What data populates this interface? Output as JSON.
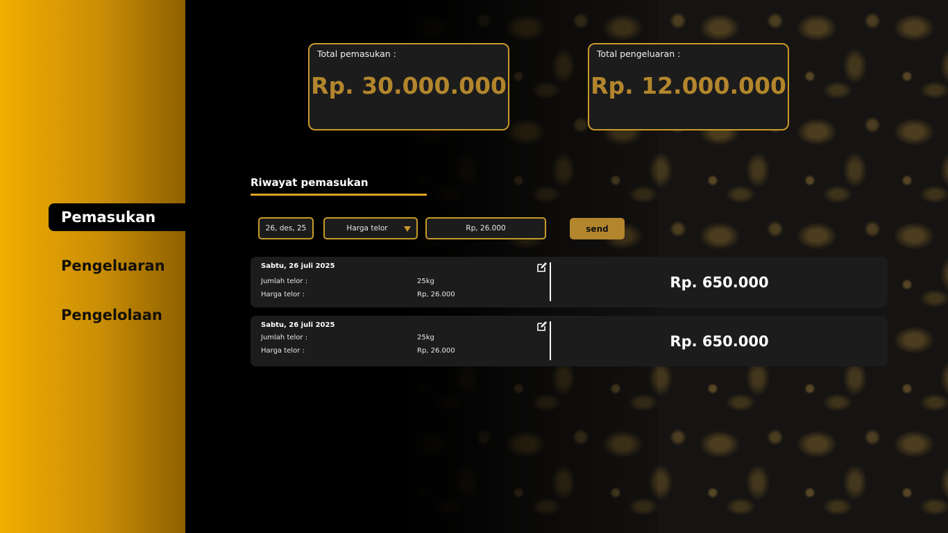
{
  "nav": {
    "items": [
      {
        "label": "Pemasukan",
        "active": true
      },
      {
        "label": "Pengeluaran",
        "active": false
      },
      {
        "label": "Pengelolaan",
        "active": false
      }
    ]
  },
  "summary": {
    "income_label": "Total pemasukan :",
    "income_value": "Rp. 30.000.000",
    "expense_label": "Total pengeluaran :",
    "expense_value": "Rp. 12.000.000"
  },
  "section": {
    "title": "Riwayat pemasukan"
  },
  "form": {
    "date_value": "26, des, 25",
    "category_selected": "Harga telor",
    "price_value": "Rp, 26.000",
    "send_label": "send"
  },
  "records": [
    {
      "date": "Sabtu, 26 juli 2025",
      "qty_label": "Jumlah telor :",
      "qty_value": "25kg",
      "price_label": "Harga telor   :",
      "price_value": "Rp, 26.000",
      "amount": "Rp. 650.000"
    },
    {
      "date": "Sabtu, 26 juli 2025",
      "qty_label": "Jumlah telor :",
      "qty_value": "25kg",
      "price_label": "Harga telor   :",
      "price_value": "Rp, 26.000",
      "amount": "Rp. 650.000"
    }
  ],
  "colors": {
    "accent": "#c99a2a",
    "gold_text": "#b3862d",
    "sidebar_start": "#f2ae00",
    "sidebar_end": "#8e6000",
    "card_bg": "#1c1c1c"
  },
  "icons": {
    "edit": "edit-icon",
    "dropdown": "chevron-down-icon"
  }
}
